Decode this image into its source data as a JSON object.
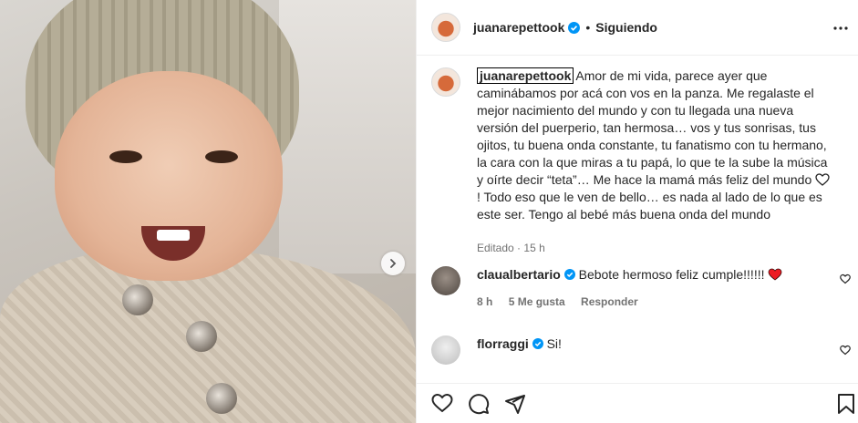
{
  "post": {
    "author": "juanarepettook",
    "follow_status": "Siguiendo",
    "separator": "•",
    "caption_user": "juanarepettook",
    "caption_text": "Amor de mi vida, parece ayer que caminábamos por acá con vos en la panza. Me regalaste el mejor nacimiento del mundo y con tu llegada una nueva versión del puerperio, tan hermosa… vos y tus sonrisas, tus ojitos, tu buena onda constante, tu fanatismo con tu hermano, la cara con la que miras a tu papá, lo que te la sube la música y oírte decir “teta”… Me hace la mamá más feliz del mundo",
    "caption_text_2": "! Todo eso que le ven de bello… es nada al lado de lo que es este ser. Tengo al bebé más buena onda del mundo",
    "edited_label": "Editado",
    "edited_sep": "·",
    "time_ago": "15 h"
  },
  "comments": [
    {
      "user": "claualbertario",
      "text": "Bebote hermoso feliz cumple!!!!!!",
      "time": "8 h",
      "likes": "5 Me gusta",
      "reply": "Responder"
    },
    {
      "user": "florraggi",
      "text": "Si!"
    }
  ],
  "colors": {
    "verified": "#0095f6",
    "heart": "#ed1c24",
    "text": "#262626",
    "muted": "#737373"
  }
}
